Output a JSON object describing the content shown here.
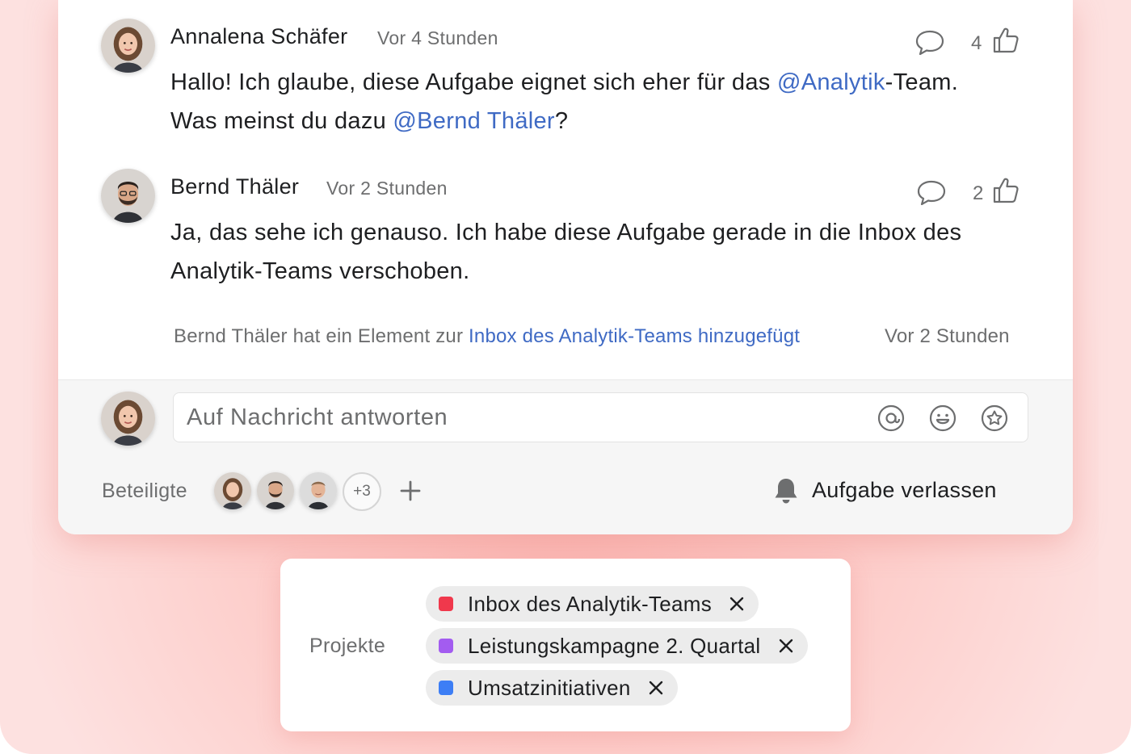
{
  "comments": [
    {
      "author": "Annalena Schäfer",
      "time": "Vor 4 Stunden",
      "line1_before": "Hallo! Ich glaube, diese Aufgabe eignet sich eher für das ",
      "line1_mention": "@Analytik",
      "line1_after": "-Team.",
      "line2_before": "Was meinst du dazu ",
      "line2_mention": "@Bernd Thäler",
      "line2_after": "?",
      "likes": "4"
    },
    {
      "author": "Bernd Thäler",
      "time": "Vor 2 Stunden",
      "line1": "Ja, das sehe ich genauso. Ich habe diese Aufgabe gerade in die Inbox des",
      "line2": "Analytik-Teams verschoben.",
      "likes": "2"
    }
  ],
  "activity": {
    "text": "Bernd Thäler hat ein Element zur ",
    "link": "Inbox des Analytik-Teams hinzugefügt",
    "time": "Vor 2 Stunden"
  },
  "reply": {
    "placeholder": "Auf Nachricht antworten",
    "icons": [
      "at-icon",
      "smiley-icon",
      "star-icon"
    ]
  },
  "participants": {
    "label": "Beteiligte",
    "more": "+3"
  },
  "leave_task": "Aufgabe verlassen",
  "projects": {
    "label": "Projekte",
    "items": [
      {
        "name": "Inbox des Analytik-Teams",
        "color": "#f0384c"
      },
      {
        "name": "Leistungskampagne 2. Quartal",
        "color": "#a35cf0"
      },
      {
        "name": "Umsatzinitiativen",
        "color": "#3d7ef5"
      }
    ]
  },
  "colors": {
    "mention": "#3f6ac4",
    "background": "#fde1e0"
  }
}
